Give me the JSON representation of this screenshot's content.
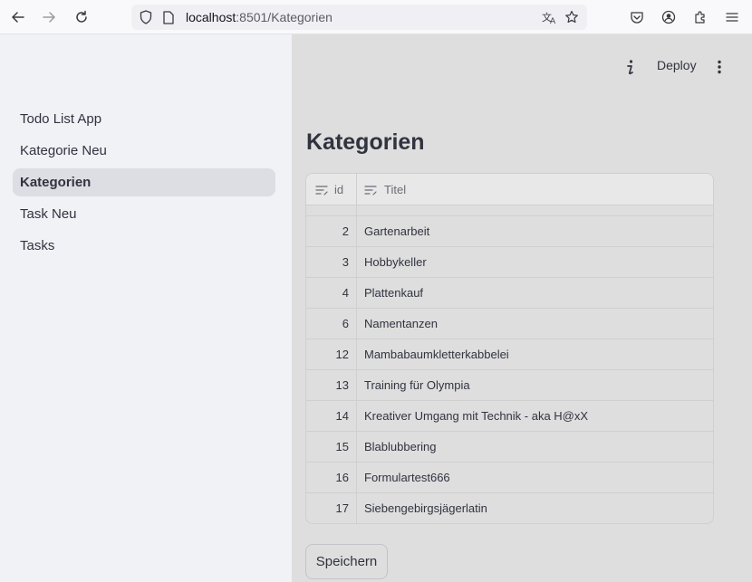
{
  "browser": {
    "url_host": "localhost",
    "url_path": ":8501/Kategorien",
    "icons": [
      "back-arrow-icon",
      "forward-arrow-icon",
      "reload-icon",
      "shield-icon",
      "page-icon",
      "translate-icon",
      "bookmark-star-icon",
      "pocket-icon",
      "account-icon",
      "extensions-icon",
      "menu-icon"
    ]
  },
  "sidebar": {
    "items": [
      {
        "label": "Todo List App",
        "active": false
      },
      {
        "label": "Kategorie Neu",
        "active": false
      },
      {
        "label": "Kategorien",
        "active": true
      },
      {
        "label": "Task Neu",
        "active": false
      },
      {
        "label": "Tasks",
        "active": false
      }
    ]
  },
  "header": {
    "deploy_label": "Deploy"
  },
  "main": {
    "title": "Kategorien",
    "table": {
      "columns": [
        "id",
        "Titel"
      ],
      "rows": [
        {
          "id": "2",
          "title": "Gartenarbeit"
        },
        {
          "id": "3",
          "title": "Hobbykeller"
        },
        {
          "id": "4",
          "title": "Plattenkauf"
        },
        {
          "id": "6",
          "title": "Namentanzen"
        },
        {
          "id": "12",
          "title": "Mambabaumkletterkabbelei"
        },
        {
          "id": "13",
          "title": "Training für Olympia"
        },
        {
          "id": "14",
          "title": "Kreativer Umgang mit Technik - aka H@xX"
        },
        {
          "id": "15",
          "title": "Blablubbering"
        },
        {
          "id": "16",
          "title": "Formulartest666"
        },
        {
          "id": "17",
          "title": "Siebengebirgsjägerlatin"
        }
      ]
    },
    "save_label": "Speichern"
  }
}
